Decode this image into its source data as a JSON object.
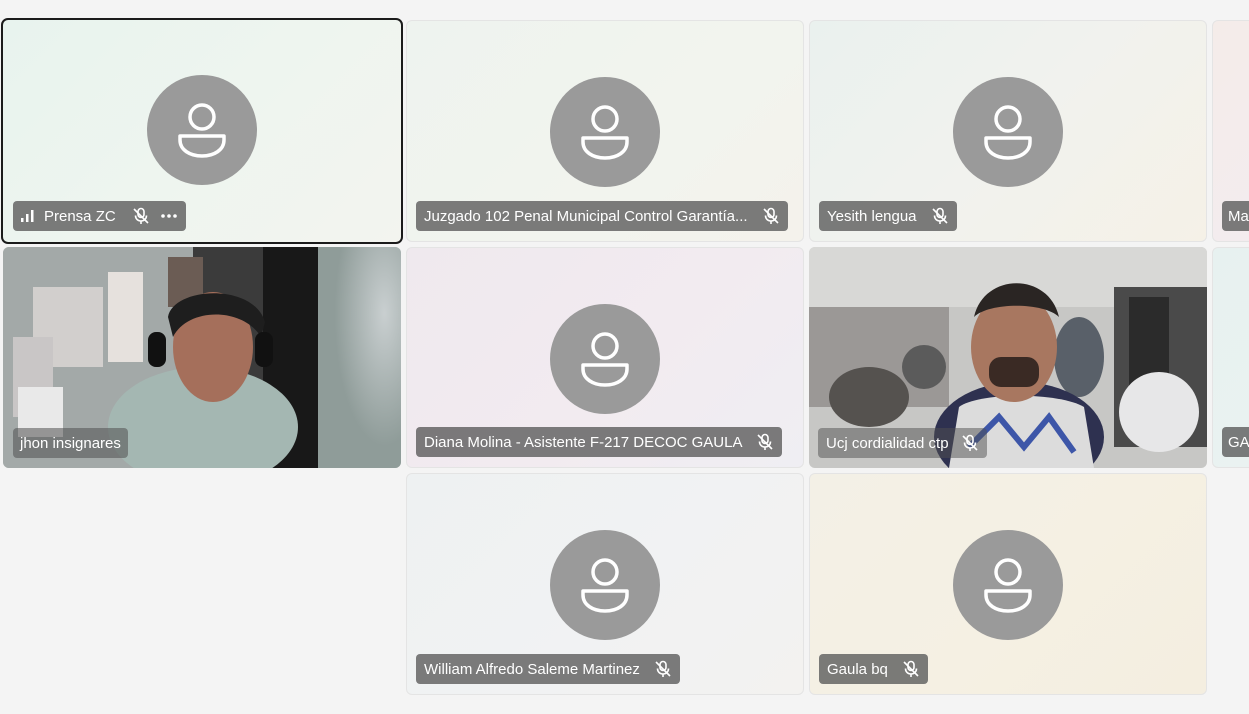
{
  "participants": [
    {
      "name": "Prensa ZC",
      "muted": true,
      "active": true
    },
    {
      "name": "Juzgado 102 Penal Municipal Control Garantía...",
      "muted": true
    },
    {
      "name": "Yesith lengua",
      "muted": true
    },
    {
      "name": "Ma"
    },
    {
      "name": "jhon insignares",
      "video": true
    },
    {
      "name": "Diana Molina - Asistente F-217 DECOC GAULA",
      "muted": true
    },
    {
      "name": "Ucj cordialidad ctp",
      "muted": true,
      "video": true
    },
    {
      "name": "GA"
    },
    {
      "name": "William Alfredo Saleme Martinez",
      "muted": true
    },
    {
      "name": "Gaula bq",
      "muted": true
    }
  ],
  "icons": {
    "avatar": "person-icon",
    "mic": "mic-off-icon",
    "signal": "signal-bars-icon",
    "more": "more-options-icon"
  },
  "colors": {
    "avatar": "#9a9a9a",
    "nameplate": "#5f5f5f",
    "active_border": "#1b1b1b"
  }
}
